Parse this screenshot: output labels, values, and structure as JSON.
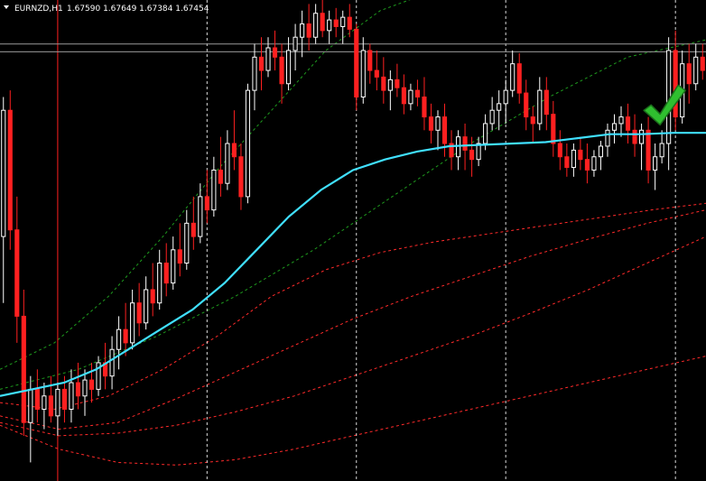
{
  "header": {
    "menu_icon": "triangle-down-icon",
    "symbol": "EURNZD,H1",
    "prices": "1.67590 1.67649 1.67384 1.67454"
  },
  "colors": {
    "background": "#000000",
    "bull": "#ffffff",
    "bear": "#ff2020",
    "ma": "#40e0ff",
    "green_band": "#1e9a1e",
    "red_band": "#ff2a2a",
    "vline": "#ffffff",
    "red_vline": "#ff2020",
    "hline": "#9a9a9a",
    "checkmark": "#2fbf2f"
  },
  "annotation_icon": "checkmark-icon",
  "chart_data": {
    "type": "candlestick",
    "grid": false,
    "ylim": [
      1.6436,
      1.6798
    ],
    "symbol": "EURNZD",
    "timeframe": "H1",
    "last_ohlc": {
      "open": 1.6759,
      "high": 1.67649,
      "low": 1.67384,
      "close": 1.67454
    },
    "candles": [
      [
        1.662,
        1.6725,
        1.657,
        1.6715
      ],
      [
        1.6715,
        1.673,
        1.661,
        1.6625
      ],
      [
        1.6625,
        1.665,
        1.654,
        1.656
      ],
      [
        1.656,
        1.658,
        1.647,
        1.648
      ],
      [
        1.648,
        1.6515,
        1.645,
        1.6505
      ],
      [
        1.6505,
        1.652,
        1.648,
        1.649
      ],
      [
        1.649,
        1.651,
        1.6475,
        1.65
      ],
      [
        1.65,
        1.6515,
        1.648,
        1.6485
      ],
      [
        1.6485,
        1.651,
        1.647,
        1.6505
      ],
      [
        1.6505,
        1.6515,
        1.648,
        1.649
      ],
      [
        1.649,
        1.652,
        1.648,
        1.651
      ],
      [
        1.651,
        1.6525,
        1.649,
        1.65
      ],
      [
        1.65,
        1.652,
        1.6485,
        1.6512
      ],
      [
        1.6512,
        1.6525,
        1.6495,
        1.6505
      ],
      [
        1.6505,
        1.653,
        1.65,
        1.6525
      ],
      [
        1.6525,
        1.654,
        1.6505,
        1.6515
      ],
      [
        1.6515,
        1.6545,
        1.6505,
        1.6535
      ],
      [
        1.6535,
        1.656,
        1.652,
        1.655
      ],
      [
        1.655,
        1.657,
        1.653,
        1.654
      ],
      [
        1.654,
        1.658,
        1.6535,
        1.657
      ],
      [
        1.657,
        1.6585,
        1.6545,
        1.6555
      ],
      [
        1.6555,
        1.659,
        1.655,
        1.658
      ],
      [
        1.658,
        1.66,
        1.656,
        1.657
      ],
      [
        1.657,
        1.661,
        1.6565,
        1.66
      ],
      [
        1.66,
        1.6615,
        1.6575,
        1.6585
      ],
      [
        1.6585,
        1.662,
        1.658,
        1.661
      ],
      [
        1.661,
        1.663,
        1.659,
        1.66
      ],
      [
        1.66,
        1.664,
        1.6595,
        1.663
      ],
      [
        1.663,
        1.665,
        1.661,
        1.662
      ],
      [
        1.662,
        1.666,
        1.6615,
        1.665
      ],
      [
        1.665,
        1.667,
        1.663,
        1.664
      ],
      [
        1.664,
        1.668,
        1.6635,
        1.667
      ],
      [
        1.667,
        1.6695,
        1.665,
        1.666
      ],
      [
        1.666,
        1.67,
        1.6655,
        1.669
      ],
      [
        1.669,
        1.6715,
        1.667,
        1.668
      ],
      [
        1.668,
        1.669,
        1.664,
        1.665
      ],
      [
        1.665,
        1.6735,
        1.6645,
        1.673
      ],
      [
        1.673,
        1.6765,
        1.6715,
        1.6755
      ],
      [
        1.6755,
        1.677,
        1.673,
        1.6745
      ],
      [
        1.6745,
        1.677,
        1.674,
        1.6762
      ],
      [
        1.6762,
        1.6775,
        1.6745,
        1.6755
      ],
      [
        1.6755,
        1.6765,
        1.672,
        1.6735
      ],
      [
        1.6735,
        1.677,
        1.673,
        1.676
      ],
      [
        1.676,
        1.678,
        1.6745,
        1.677
      ],
      [
        1.677,
        1.679,
        1.6755,
        1.678
      ],
      [
        1.678,
        1.6795,
        1.676,
        1.677
      ],
      [
        1.677,
        1.6795,
        1.6765,
        1.6788
      ],
      [
        1.6788,
        1.6798,
        1.677,
        1.6775
      ],
      [
        1.6775,
        1.679,
        1.6765,
        1.6783
      ],
      [
        1.6783,
        1.6792,
        1.677,
        1.6778
      ],
      [
        1.6778,
        1.679,
        1.6765,
        1.6785
      ],
      [
        1.6785,
        1.6795,
        1.677,
        1.6776
      ],
      [
        1.6776,
        1.678,
        1.6715,
        1.6725
      ],
      [
        1.6725,
        1.677,
        1.672,
        1.676
      ],
      [
        1.676,
        1.6765,
        1.6735,
        1.6745
      ],
      [
        1.6745,
        1.676,
        1.673,
        1.674
      ],
      [
        1.674,
        1.6755,
        1.672,
        1.673
      ],
      [
        1.673,
        1.6745,
        1.6715,
        1.6738
      ],
      [
        1.6738,
        1.675,
        1.6725,
        1.6732
      ],
      [
        1.6732,
        1.6742,
        1.6712,
        1.672
      ],
      [
        1.672,
        1.6735,
        1.6715,
        1.673
      ],
      [
        1.673,
        1.6738,
        1.6718,
        1.6725
      ],
      [
        1.6725,
        1.674,
        1.67,
        1.671
      ],
      [
        1.671,
        1.672,
        1.669,
        1.67
      ],
      [
        1.67,
        1.6715,
        1.6685,
        1.671
      ],
      [
        1.671,
        1.672,
        1.668,
        1.669
      ],
      [
        1.669,
        1.67,
        1.667,
        1.668
      ],
      [
        1.668,
        1.67,
        1.667,
        1.6695
      ],
      [
        1.6695,
        1.6705,
        1.667,
        1.6685
      ],
      [
        1.6685,
        1.6695,
        1.6665,
        1.6678
      ],
      [
        1.6678,
        1.6695,
        1.6673,
        1.669
      ],
      [
        1.669,
        1.6712,
        1.6685,
        1.6705
      ],
      [
        1.6705,
        1.6725,
        1.67,
        1.6715
      ],
      [
        1.6715,
        1.673,
        1.67,
        1.672
      ],
      [
        1.672,
        1.6738,
        1.6705,
        1.673
      ],
      [
        1.673,
        1.676,
        1.6725,
        1.675
      ],
      [
        1.675,
        1.6758,
        1.672,
        1.6728
      ],
      [
        1.6728,
        1.6738,
        1.67,
        1.671
      ],
      [
        1.671,
        1.6718,
        1.669,
        1.6705
      ],
      [
        1.6705,
        1.674,
        1.67,
        1.673
      ],
      [
        1.673,
        1.674,
        1.67,
        1.6712
      ],
      [
        1.6712,
        1.6722,
        1.668,
        1.669
      ],
      [
        1.669,
        1.67,
        1.667,
        1.668
      ],
      [
        1.668,
        1.669,
        1.6665,
        1.6672
      ],
      [
        1.6672,
        1.669,
        1.6665,
        1.6685
      ],
      [
        1.6685,
        1.6695,
        1.667,
        1.6678
      ],
      [
        1.6678,
        1.669,
        1.666,
        1.667
      ],
      [
        1.667,
        1.6685,
        1.6665,
        1.668
      ],
      [
        1.668,
        1.6692,
        1.667,
        1.6688
      ],
      [
        1.6688,
        1.6705,
        1.668,
        1.67
      ],
      [
        1.67,
        1.6712,
        1.669,
        1.6705
      ],
      [
        1.6705,
        1.6718,
        1.6695,
        1.671
      ],
      [
        1.671,
        1.672,
        1.669,
        1.67
      ],
      [
        1.67,
        1.6712,
        1.668,
        1.669
      ],
      [
        1.669,
        1.6705,
        1.667,
        1.67
      ],
      [
        1.67,
        1.671,
        1.666,
        1.667
      ],
      [
        1.667,
        1.669,
        1.6655,
        1.668
      ],
      [
        1.668,
        1.67,
        1.6675,
        1.669
      ],
      [
        1.669,
        1.677,
        1.667,
        1.676
      ],
      [
        1.676,
        1.6775,
        1.67,
        1.671
      ],
      [
        1.671,
        1.676,
        1.6705,
        1.675
      ],
      [
        1.675,
        1.6765,
        1.672,
        1.6735
      ],
      [
        1.6735,
        1.6765,
        1.673,
        1.6755
      ],
      [
        1.6755,
        1.6765,
        1.6738,
        1.6745
      ]
    ],
    "ma": [
      1.65,
      1.6505,
      1.651,
      1.652,
      1.6535,
      1.655,
      1.6565,
      1.6585,
      1.661,
      1.6635,
      1.6655,
      1.667,
      1.6678,
      1.6684,
      1.6688,
      1.6689,
      1.669,
      1.6691,
      1.6694,
      1.6697,
      1.6697,
      1.6698,
      1.6698
    ],
    "green_upper": [
      1.652,
      1.654,
      1.6575,
      1.662,
      1.667,
      1.6715,
      1.676,
      1.679,
      1.6805,
      1.6815,
      1.6825,
      1.6835,
      1.6845,
      1.685
    ],
    "green_lower": [
      1.6505,
      1.652,
      1.6545,
      1.6575,
      1.661,
      1.665,
      1.669,
      1.6725,
      1.6755,
      1.6768
    ],
    "red_bands": [
      [
        1.6495,
        1.649,
        1.65,
        1.652,
        1.6545,
        1.6575,
        1.6595,
        1.6608,
        1.6616,
        1.6622,
        1.6628,
        1.6634,
        1.664,
        1.6645
      ],
      [
        1.6485,
        1.6475,
        1.648,
        1.6498,
        1.6518,
        1.6538,
        1.6558,
        1.6575,
        1.659,
        1.6605,
        1.6618,
        1.663,
        1.664
      ],
      [
        1.648,
        1.647,
        1.6472,
        1.6478,
        1.6488,
        1.65,
        1.6515,
        1.653,
        1.6545,
        1.6562,
        1.658,
        1.66,
        1.662
      ],
      [
        1.6478,
        1.646,
        1.645,
        1.6448,
        1.6452,
        1.646,
        1.647,
        1.648,
        1.649,
        1.65,
        1.651,
        1.652,
        1.653
      ]
    ],
    "red_vline_candle": 8,
    "white_vlines_candle": [
      30,
      52,
      74,
      99
    ],
    "hlines": [
      1.67649,
      1.6759
    ],
    "checkmark_candle": 97
  }
}
